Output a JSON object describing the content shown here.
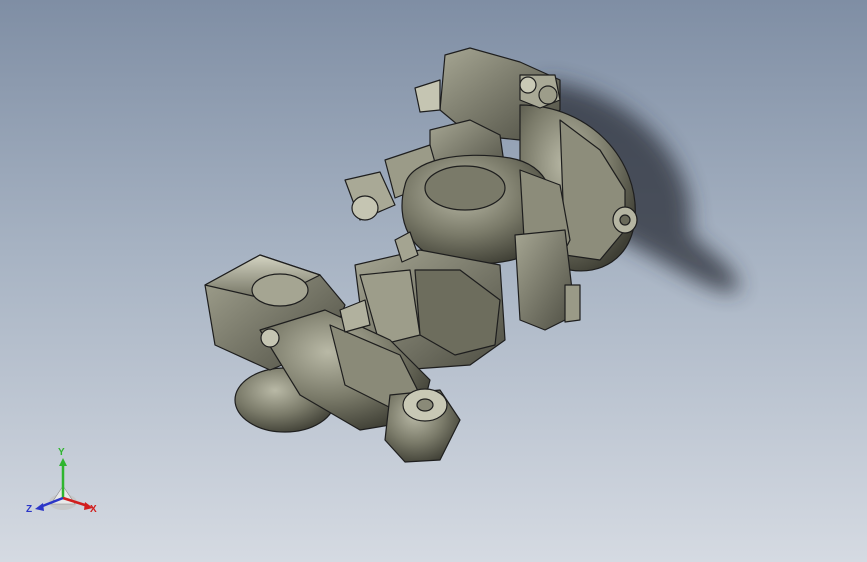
{
  "viewport": {
    "background_top": "#7f8ea4",
    "background_bottom": "#d5dae2",
    "model_color": "#7b7b6a",
    "edge_color": "#1e1e1e"
  },
  "triad": {
    "y_label": "Y",
    "z_label": "Z",
    "x_label": "X",
    "y_color": "#2fb52f",
    "x_color": "#d11e1e",
    "z_color": "#2b36c8"
  }
}
